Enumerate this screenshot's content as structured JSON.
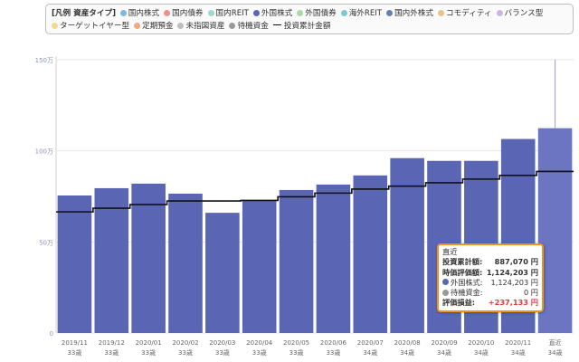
{
  "legend": {
    "title": "[凡例 資産タイプ]",
    "items": [
      {
        "label": "国内株式",
        "color": "#7fb8e0",
        "kind": "dot"
      },
      {
        "label": "国内債券",
        "color": "#ef8f8f",
        "kind": "dot"
      },
      {
        "label": "国内REIT",
        "color": "#9ed9cf",
        "kind": "dot"
      },
      {
        "label": "外国株式",
        "color": "#5a66b4",
        "kind": "dot"
      },
      {
        "label": "外国債券",
        "color": "#a8d8a8",
        "kind": "dot"
      },
      {
        "label": "海外REIT",
        "color": "#7ccad0",
        "kind": "dot"
      },
      {
        "label": "国内外株式",
        "color": "#6a7fb0",
        "kind": "dot"
      },
      {
        "label": "コモディティ",
        "color": "#e6c48a",
        "kind": "dot"
      },
      {
        "label": "バランス型",
        "color": "#c8b8e0",
        "kind": "dot"
      },
      {
        "label": "ターゲットイヤー型",
        "color": "#f4d88c",
        "kind": "dot"
      },
      {
        "label": "定期預金",
        "color": "#f4a87c",
        "kind": "dot"
      },
      {
        "label": "未指図資産",
        "color": "#bdbdbd",
        "kind": "dot"
      },
      {
        "label": "待機資金",
        "color": "#9a9a9a",
        "kind": "dot"
      },
      {
        "label": "投資累計金額",
        "color": "#111111",
        "kind": "dash"
      }
    ]
  },
  "tooltip": {
    "title": "直近",
    "cumulative_label": "投資累計額:",
    "cumulative_value": "887,070 円",
    "market_label": "時価評価額:",
    "market_value": "1,124,203 円",
    "foreign_label": "外国株式:",
    "foreign_value": "1,124,203 円",
    "foreign_color": "#5a66b4",
    "standby_label": "待機資金:",
    "standby_value": "0 円",
    "standby_color": "#9a9a9a",
    "profit_label": "評価損益:",
    "profit_value": "+237,133 円"
  },
  "chart_data": {
    "type": "bar",
    "categories": [
      "2019/11",
      "2019/12",
      "2020/01",
      "2020/02",
      "2020/03",
      "2020/04",
      "2020/05",
      "2020/06",
      "2020/07",
      "2020/08",
      "2020/09",
      "2020/10",
      "2020/11",
      "直近"
    ],
    "sublabels": [
      "33歳",
      "33歳",
      "33歳",
      "33歳",
      "33歳",
      "33歳",
      "33歳",
      "33歳",
      "34歳",
      "34歳",
      "34歳",
      "34歳",
      "34歳",
      "34歳"
    ],
    "series": [
      {
        "name": "外国株式",
        "color": "#5a66b4",
        "values": [
          755000,
          795000,
          820000,
          765000,
          660000,
          730000,
          785000,
          815000,
          865000,
          960000,
          945000,
          945000,
          1065000,
          1124203
        ]
      },
      {
        "name": "投資累計金額",
        "color": "#111111",
        "type": "step-line",
        "values": [
          665000,
          685000,
          705000,
          725000,
          725000,
          728000,
          748000,
          768000,
          790000,
          806000,
          825000,
          845000,
          865000,
          887070
        ]
      }
    ],
    "y_ticks": [
      0,
      500000,
      1000000,
      1500000
    ],
    "y_tick_labels": [
      "0",
      "50万",
      "100万",
      "150万"
    ],
    "ylim": [
      0,
      1500000
    ],
    "grid": true,
    "highlighted_index": 13,
    "highlight_color": "#6b75c2"
  }
}
